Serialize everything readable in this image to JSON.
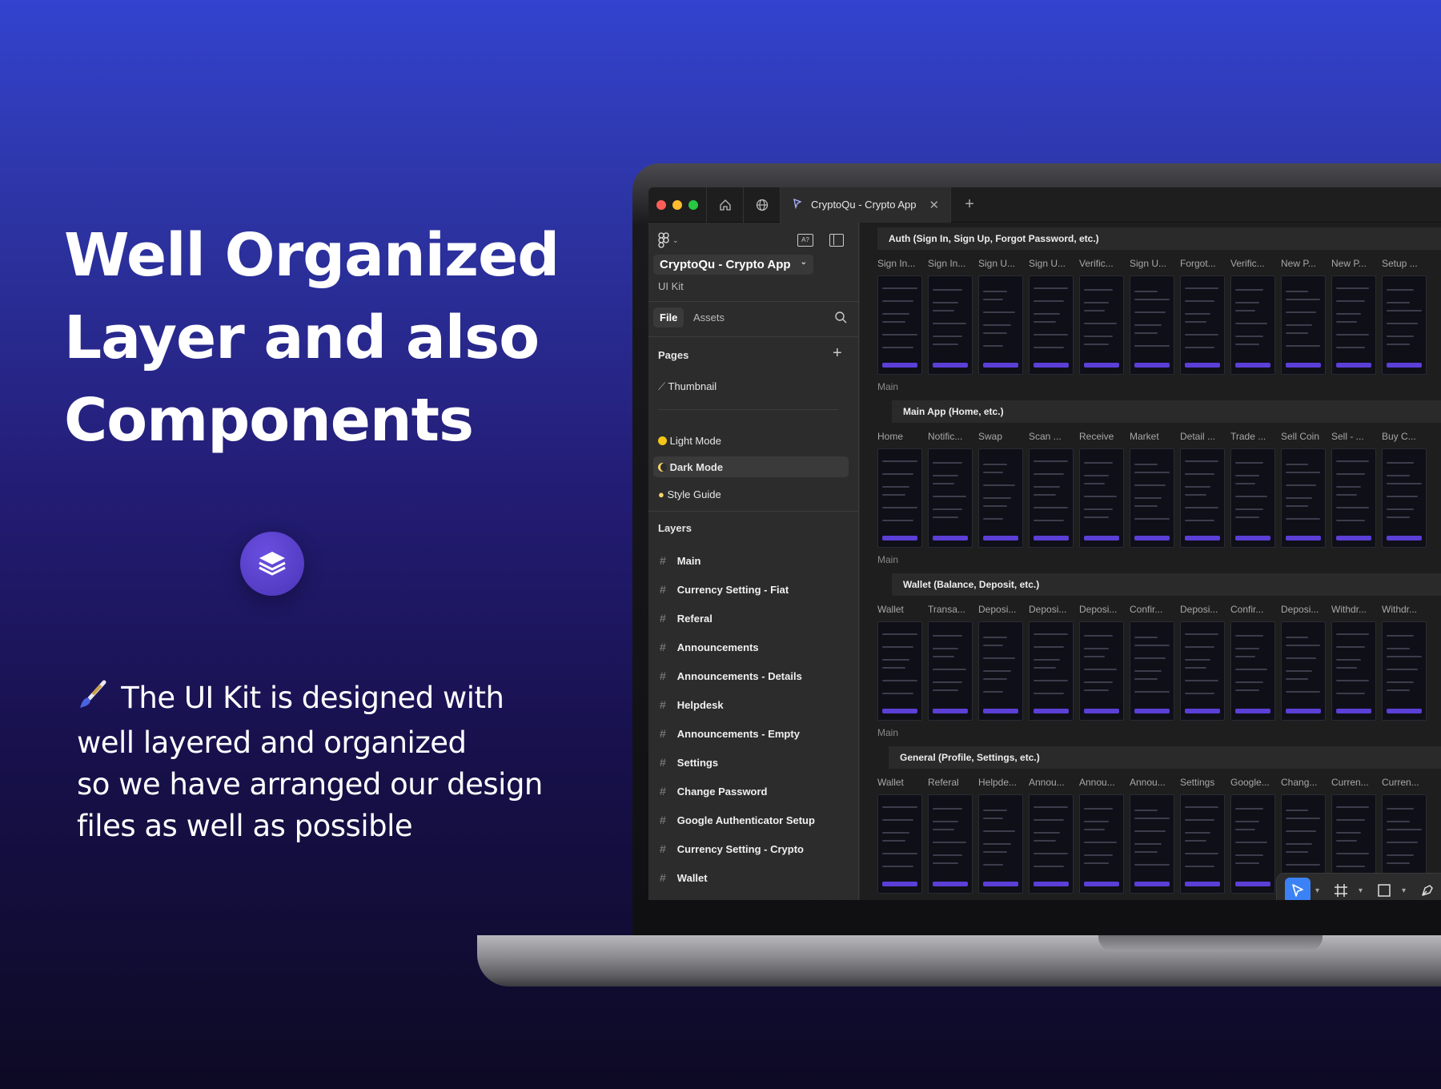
{
  "headline": {
    "line1": "Well Organized",
    "line2": "Layer and also",
    "line3": "Components"
  },
  "description": {
    "line1": "The UI Kit is designed with",
    "line2": "well layered and organized",
    "line3": "so we have arranged our design",
    "line4": "files as well as possible"
  },
  "browser": {
    "tab_title": "CryptoQu - Crypto App"
  },
  "sidebar": {
    "file_name": "CryptoQu - Crypto App",
    "file_subtitle": "UI Kit",
    "tabs": {
      "file": "File",
      "assets": "Assets"
    },
    "pages_label": "Pages",
    "pages": [
      "Thumbnail",
      "Light Mode",
      "Dark Mode",
      "Style Guide"
    ],
    "layers_label": "Layers",
    "layers": [
      "Main",
      "Currency Setting - Fiat",
      "Referal",
      "Announcements",
      "Announcements - Details",
      "Helpdesk",
      "Announcements - Empty",
      "Settings",
      "Change Password",
      "Google Authenticator Setup",
      "Currency Setting - Crypto",
      "Wallet"
    ]
  },
  "canvas": {
    "sections": [
      {
        "title": "Auth (Sign In, Sign Up, Forgot Password, etc.)",
        "frames": [
          "Sign In...",
          "Sign In...",
          "Sign U...",
          "Sign U...",
          "Verific...",
          "Sign U...",
          "Forgot...",
          "Verific...",
          "New P...",
          "New P...",
          "Setup ..."
        ]
      },
      {
        "main_label": "Main",
        "title": "Main App (Home, etc.)",
        "frames": [
          "Home",
          "Notific...",
          "Swap",
          "Scan ...",
          "Receive",
          "Market",
          "Detail ...",
          "Trade ...",
          "Sell Coin",
          "Sell - ...",
          "Buy C..."
        ]
      },
      {
        "main_label": "Main",
        "title": "Wallet (Balance, Deposit, etc.)",
        "frames": [
          "Wallet",
          "Transa...",
          "Deposi...",
          "Deposi...",
          "Deposi...",
          "Confir...",
          "Deposi...",
          "Confir...",
          "Deposi...",
          "Withdr...",
          "Withdr..."
        ]
      },
      {
        "main_label": "Main",
        "title": "General (Profile, Settings, etc.)",
        "frames": [
          "Wallet",
          "Referal",
          "Helpde...",
          "Annou...",
          "Annou...",
          "Annou...",
          "Settings",
          "Google...",
          "Chang...",
          "Curren...",
          "Curren..."
        ]
      }
    ]
  },
  "colors": {
    "accent": "#5b3fd6",
    "select_blue": "#3b82f6"
  }
}
